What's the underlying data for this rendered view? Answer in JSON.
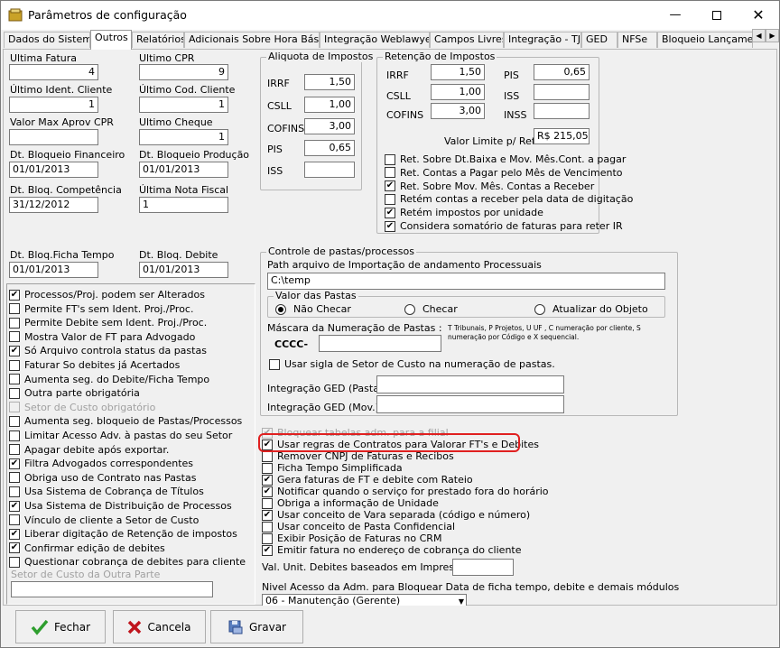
{
  "window": {
    "title": "Parâmetros de configuração"
  },
  "tabs": [
    "Dados do Sistema",
    "Outros",
    "Relatórios",
    "Adicionais Sobre Hora Básica",
    "Integração Weblawyer",
    "Campos Livres",
    "Integração - TJ",
    "GED",
    "NFSe",
    "Bloqueio Lançament"
  ],
  "left": {
    "ultima_fatura_label": "Ultima Fatura",
    "ultima_fatura": "4",
    "ultimo_cpr_label": "Ultimo CPR",
    "ultimo_cpr": "9",
    "ultimo_ident_cliente_label": "Último Ident. Cliente",
    "ultimo_ident_cliente": "1",
    "ultimo_cod_cliente_label": "Último Cod. Cliente",
    "ultimo_cod_cliente": "1",
    "valor_max_label": "Valor Max Aprov CPR",
    "valor_max": "",
    "ultimo_cheque_label": "Ultimo Cheque",
    "ultimo_cheque": "1",
    "dt_bloq_fin_label": "Dt. Bloqueio Financeiro",
    "dt_bloq_fin": "01/01/2013",
    "dt_bloq_prod_label": "Dt. Bloqueio Produção",
    "dt_bloq_prod": "01/01/2013",
    "dt_bloq_comp_label": "Dt. Bloq. Competência",
    "dt_bloq_comp": "31/12/2012",
    "ultima_nf_label": "Última Nota Fiscal",
    "ultima_nf": "1",
    "dt_bloq_ficha_label": "Dt. Bloq.Ficha Tempo",
    "dt_bloq_ficha": "01/01/2013",
    "dt_bloq_debite_label": "Dt. Bloq. Debite",
    "dt_bloq_debite": "01/01/2013"
  },
  "left_checks": [
    {
      "label": "Processos/Proj. podem ser Alterados",
      "checked": true
    },
    {
      "label": "Permite FT's sem Ident. Proj./Proc.",
      "checked": false
    },
    {
      "label": "Permite Debite sem Ident. Proj./Proc.",
      "checked": false
    },
    {
      "label": "Mostra Valor de FT para Advogado",
      "checked": false
    },
    {
      "label": "Só Arquivo controla status da pastas",
      "checked": true
    },
    {
      "label": "Faturar So debites já Acertados",
      "checked": false
    },
    {
      "label": "Aumenta seg. do Debite/Ficha Tempo",
      "checked": false
    },
    {
      "label": "Outra parte obrigatória",
      "checked": false
    },
    {
      "label": "Setor de Custo obrigatório",
      "checked": false,
      "disabled": true
    },
    {
      "label": "Aumenta seg. bloqueio de Pastas/Processos",
      "checked": false
    },
    {
      "label": "Limitar Acesso Adv. à pastas do seu Setor",
      "checked": false
    },
    {
      "label": "Apagar debite após exportar.",
      "checked": false
    },
    {
      "label": "Filtra Advogados correspondentes",
      "checked": true
    },
    {
      "label": "Obriga uso de Contrato nas Pastas",
      "checked": false
    },
    {
      "label": "Usa Sistema de Cobrança de Títulos",
      "checked": false
    },
    {
      "label": "Usa Sistema de Distribuição de Processos",
      "checked": true
    },
    {
      "label": "Vínculo de cliente a Setor de Custo",
      "checked": false
    },
    {
      "label": "Liberar digitação de Retenção de impostos",
      "checked": true
    },
    {
      "label": "Confirmar edição de debites",
      "checked": true
    },
    {
      "label": "Questionar cobrança de debites para cliente",
      "checked": false
    }
  ],
  "setor_outra_parte_label": "Setor de Custo da Outra Parte",
  "aliquota": {
    "title": "Aliquota de Impostos",
    "irrf_label": "IRRF",
    "irrf": "1,50",
    "csll_label": "CSLL",
    "csll": "1,00",
    "cofins_label": "COFINS",
    "cofins": "3,00",
    "pis_label": "PIS",
    "pis": "0,65",
    "iss_label": "ISS",
    "iss": ""
  },
  "retencao": {
    "title": "Retenção de Impostos",
    "irrf_label": "IRRF",
    "irrf": "1,50",
    "csll_label": "CSLL",
    "csll": "1,00",
    "cofins_label": "COFINS",
    "cofins": "3,00",
    "pis_label": "PIS",
    "pis": "0,65",
    "iss_label": "ISS",
    "iss": "",
    "inss_label": "INSS",
    "inss": "",
    "limite_label": "Valor Limite p/ Ret.",
    "limite": "R$ 215,05"
  },
  "retencao_checks": [
    {
      "label": "Ret. Sobre Dt.Baixa e Mov. Mês.Cont. a pagar",
      "checked": false
    },
    {
      "label": "Ret. Contas a Pagar pelo Mês de Vencimento",
      "checked": false
    },
    {
      "label": "Ret. Sobre Mov. Mês. Contas a Receber",
      "checked": true
    },
    {
      "label": "Retém contas a receber pela data de digitação",
      "checked": false
    },
    {
      "label": "Retém impostos por unidade",
      "checked": true
    },
    {
      "label": "Considera somatório de faturas para reter IR",
      "checked": true
    }
  ],
  "pastas": {
    "title": "Controle de pastas/processos",
    "path_label": "Path arquivo de Importação de andamento Processuais",
    "path": "C:\\temp",
    "valor_title": "Valor das Pastas",
    "r_nao": "Não Checar",
    "r_checar": "Checar",
    "r_atualizar": "Atualizar do Objeto",
    "mascara_label": "Máscara da Numeração de Pastas :",
    "mascara_prefix": "CCCC-",
    "mascara": "",
    "hint": "T Tribunais, P Projetos, U UF , C numeração por cliente, S numeração por Código e X sequencial.",
    "sigla_label": "Usar sigla de Setor de Custo na numeração de pastas.",
    "ged_pasta_label": "Integração GED (Pasta):",
    "ged_pasta": "",
    "ged_mov_label": "Integração GED (Mov.):",
    "ged_mov": ""
  },
  "right_checks": [
    {
      "label": "Bloquear tabelas adm. para a filial",
      "checked": true,
      "disabled": true
    },
    {
      "label": "Usar regras de Contratos para Valorar FT's e Debites",
      "checked": true
    },
    {
      "label": "Remover CNPJ de Faturas e Recibos",
      "checked": false
    },
    {
      "label": "Ficha Tempo Simplificada",
      "checked": false
    },
    {
      "label": "Gera faturas de FT e debite com Rateio",
      "checked": true
    },
    {
      "label": "Notificar quando o serviço for prestado fora do horário",
      "checked": true
    },
    {
      "label": "Obriga a informação de Unidade",
      "checked": false
    },
    {
      "label": "Usar conceito de Vara separada (código e número)",
      "checked": true
    },
    {
      "label": "Usar conceito de Pasta Confidencial",
      "checked": false
    },
    {
      "label": "Exibir Posição de Faturas no CRM",
      "checked": false
    },
    {
      "label": "Emitir fatura no endereço de cobrança do cliente",
      "checked": true
    }
  ],
  "val_unit_label": "Val. Unit. Debites baseados em Impressora:",
  "val_unit": "",
  "nivel_label": "Nivel Acesso da Adm. para Bloquear Data de ficha tempo, debite e demais módulos",
  "nivel_value": "06 - Manutenção (Gerente)",
  "buttons": {
    "fechar": "Fechar",
    "cancela": "Cancela",
    "gravar": "Gravar"
  },
  "colors": {
    "highlight": "#e02020",
    "check_green": "#2e9e2e",
    "cancel_red": "#c0141c"
  }
}
